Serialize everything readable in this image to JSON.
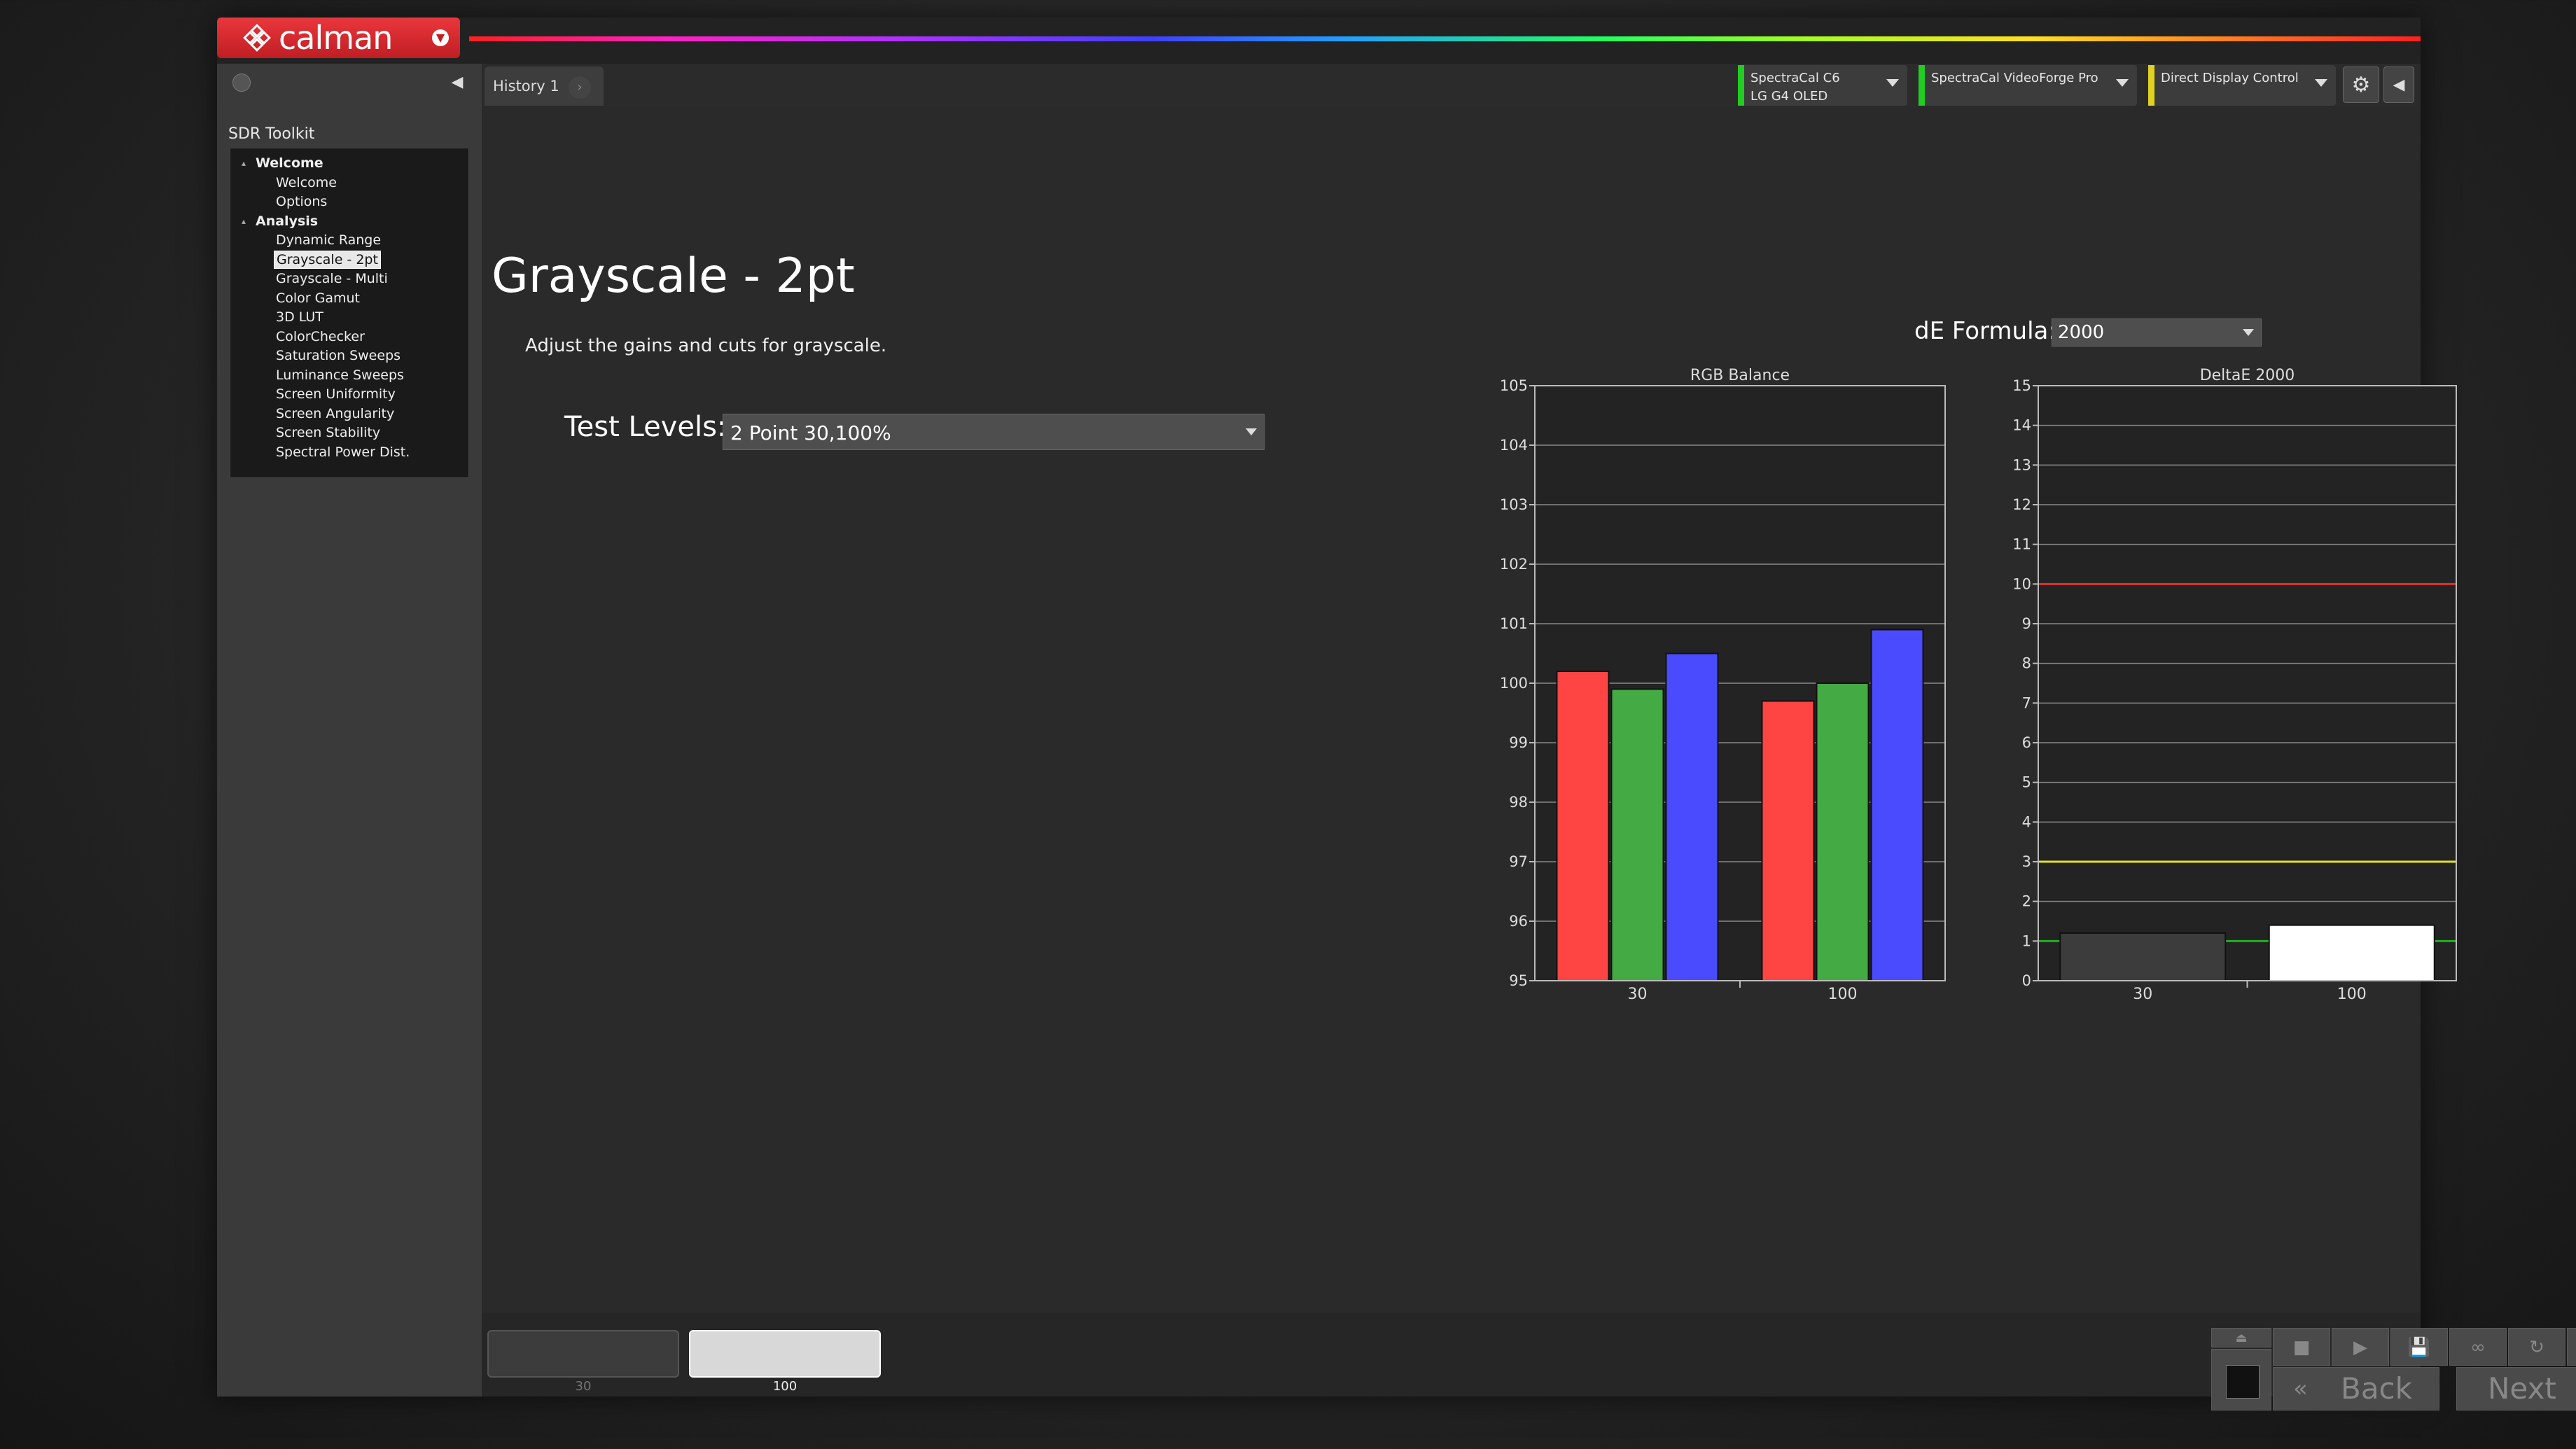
{
  "app": {
    "logo_text": "calman",
    "logo_menu_icon": "chevron-down-icon"
  },
  "sidebar": {
    "toolkit_title": "SDR Toolkit",
    "tree": [
      {
        "label": "Welcome",
        "type": "group"
      },
      {
        "label": "Welcome",
        "type": "item"
      },
      {
        "label": "Options",
        "type": "item"
      },
      {
        "label": "Analysis",
        "type": "group"
      },
      {
        "label": "Dynamic Range",
        "type": "item"
      },
      {
        "label": "Grayscale - 2pt",
        "type": "item",
        "selected": true
      },
      {
        "label": "Grayscale - Multi",
        "type": "item"
      },
      {
        "label": "Color Gamut",
        "type": "item"
      },
      {
        "label": "3D LUT",
        "type": "item"
      },
      {
        "label": "ColorChecker",
        "type": "item"
      },
      {
        "label": "Saturation Sweeps",
        "type": "item"
      },
      {
        "label": "Luminance Sweeps",
        "type": "item"
      },
      {
        "label": "Screen Uniformity",
        "type": "item"
      },
      {
        "label": "Screen Angularity",
        "type": "item"
      },
      {
        "label": "Screen Stability",
        "type": "item"
      },
      {
        "label": "Spectral Power Dist.",
        "type": "item"
      }
    ]
  },
  "tabs": [
    {
      "label": "History 1"
    }
  ],
  "devices": {
    "meter": {
      "line1": "SpectraCal C6",
      "line2": "LG G4 OLED",
      "status_color": "#22cc22"
    },
    "generator": {
      "line1": "SpectraCal VideoForge Pro",
      "status_color": "#22cc22"
    },
    "display": {
      "line1": "Direct Display Control",
      "status_color": "#e0d020"
    }
  },
  "page": {
    "title": "Grayscale - 2pt",
    "subtitle": "Adjust the gains and cuts for grayscale.",
    "test_levels_label": "Test Levels:",
    "test_levels_value": "2 Point 30,100%",
    "de_formula_label": "dE Formula:",
    "de_formula_value": "2000"
  },
  "chart_data": [
    {
      "type": "bar",
      "title": "RGB Balance",
      "categories": [
        "30",
        "100"
      ],
      "series": [
        {
          "color": "#ff4444",
          "values": [
            100.2,
            99.7
          ]
        },
        {
          "color": "#44aa44",
          "values": [
            99.9,
            100.0
          ]
        },
        {
          "color": "#4a4aff",
          "values": [
            100.5,
            100.9
          ]
        }
      ],
      "ylim": [
        95,
        105
      ],
      "yticks": [
        95,
        96,
        97,
        98,
        99,
        100,
        101,
        102,
        103,
        104,
        105
      ],
      "grid": true
    },
    {
      "type": "bar",
      "title": "DeltaE 2000",
      "categories": [
        "30",
        "100"
      ],
      "values": [
        1.2,
        1.4
      ],
      "bar_colors": [
        "#3c3c3c",
        "#ffffff"
      ],
      "ylim": [
        0,
        15
      ],
      "yticks": [
        0,
        1,
        2,
        3,
        4,
        5,
        6,
        7,
        8,
        9,
        10,
        11,
        12,
        13,
        14,
        15
      ],
      "reference_lines": [
        {
          "value": 10,
          "color": "#e03030"
        },
        {
          "value": 3,
          "color": "#e0e020"
        },
        {
          "value": 1,
          "color": "#20b020"
        }
      ],
      "grid": true
    }
  ],
  "swatches": [
    {
      "label": "30",
      "color": "#3c3c3c",
      "active": false
    },
    {
      "label": "100",
      "color": "#d8d8d8",
      "active": true
    }
  ],
  "controls": {
    "back_label": "Back",
    "next_label": "Next"
  }
}
